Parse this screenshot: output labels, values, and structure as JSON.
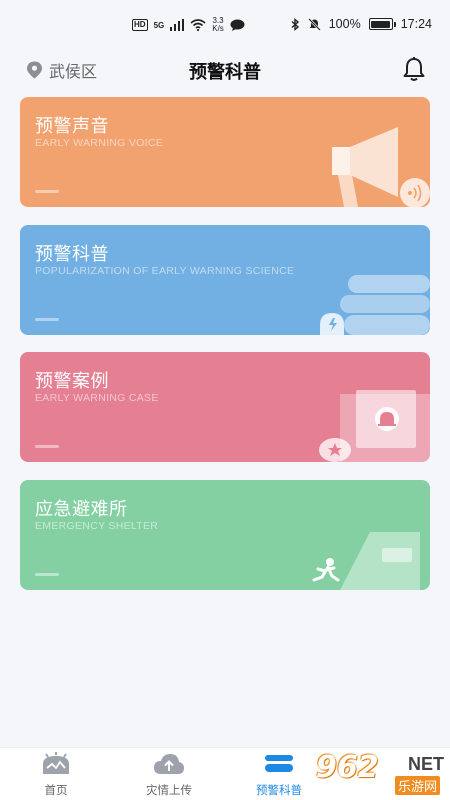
{
  "status_bar": {
    "hd": "HD",
    "network": "5G",
    "speed_value": "3.3",
    "speed_unit": "K/s",
    "battery": "100%",
    "time": "17:24"
  },
  "header": {
    "location": "武侯区",
    "title": "预警科普"
  },
  "cards": [
    {
      "title": "预警声音",
      "subtitle": "EARLY WARNING VOICE",
      "color": "#f2a26f"
    },
    {
      "title": "预警科普",
      "subtitle": "POPULARIZATION OF EARLY WARNING SCIENCE",
      "color": "#72b0e3"
    },
    {
      "title": "预警案例",
      "subtitle": "EARLY WARNING CASE",
      "color": "#e58093"
    },
    {
      "title": "应急避难所",
      "subtitle": "EMERGENCY SHELTER",
      "color": "#84d0a3"
    }
  ],
  "nav": [
    {
      "label": "首页",
      "icon": "home-icon"
    },
    {
      "label": "灾情上传",
      "icon": "cloud-upload-icon"
    },
    {
      "label": "预警科普",
      "icon": "science-icon",
      "active": true
    }
  ],
  "active_color": "#1e88e5",
  "watermark": {
    "number": "962",
    "net": "NET",
    "name": "乐游网"
  }
}
